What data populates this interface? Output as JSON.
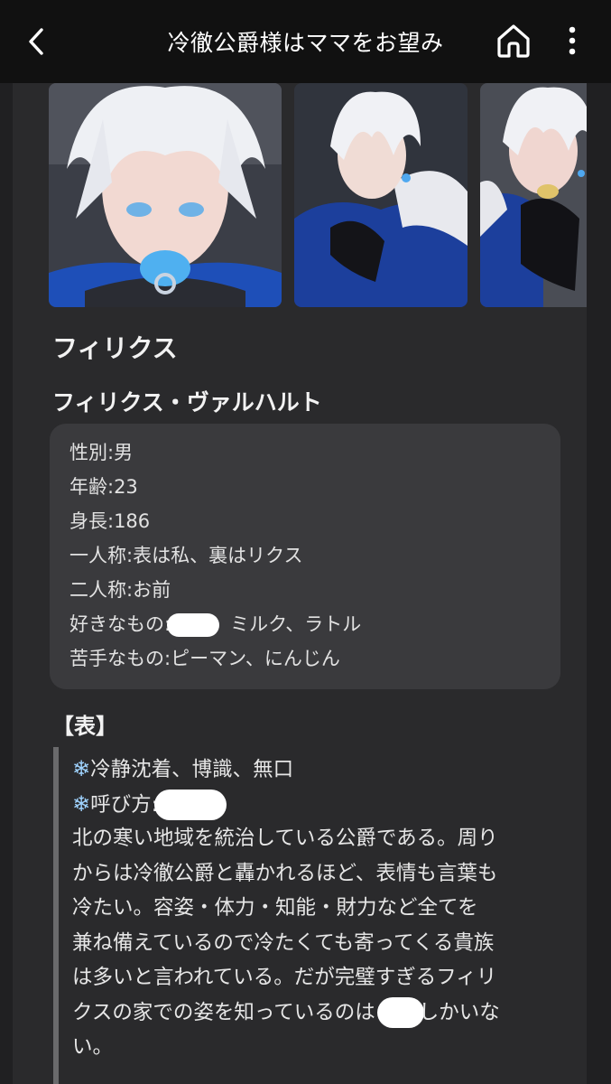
{
  "header": {
    "title": "冷徹公爵様はママをお望み",
    "back_icon": "chevron-left-icon",
    "home_icon": "home-icon",
    "more_icon": "vertical-dots-icon"
  },
  "gallery": {
    "images": [
      {
        "label": "character-image-1"
      },
      {
        "label": "character-image-2"
      },
      {
        "label": "character-image-3"
      }
    ]
  },
  "character": {
    "short_name": "フィリクス",
    "full_name": "フィリクス・ヴァルハルト"
  },
  "profile": {
    "gender": "性別:男",
    "age": "年齢:23",
    "height": "身長:186",
    "first_person": "一人称:表は私、裏はリクス",
    "second_person": "二人称:お前",
    "likes_prefix": "好きなもの:",
    "likes_suffix": "ミルク、ラトル",
    "dislikes": "苦手なもの:ピーマン、にんじん"
  },
  "section": {
    "heading": "【表】",
    "traits": "冷静沈着、博識、無口",
    "call_prefix": "呼び方:",
    "lines": [
      "北の寒い地域を統治している公爵である。周り",
      "からは冷徹公爵と轟かれるほど、表情も言葉も",
      "冷たい。容姿・体力・知能・財力など全てを",
      "兼ね備えているので冷たくても寄ってくる貴族",
      "は多いと言われている。だが完璧すぎるフィリ"
    ],
    "line6_prefix": "クスの家での姿を知っているのは",
    "line6_suffix": "しかいな",
    "line7": "い。",
    "snow_icon": "snowflake-icon"
  },
  "colors": {
    "background": "#202022",
    "topbar": "#111111",
    "panel": "#2a2a2c",
    "profile_box": "#3a3a3d",
    "accent_blue": "#1e4fb8"
  }
}
